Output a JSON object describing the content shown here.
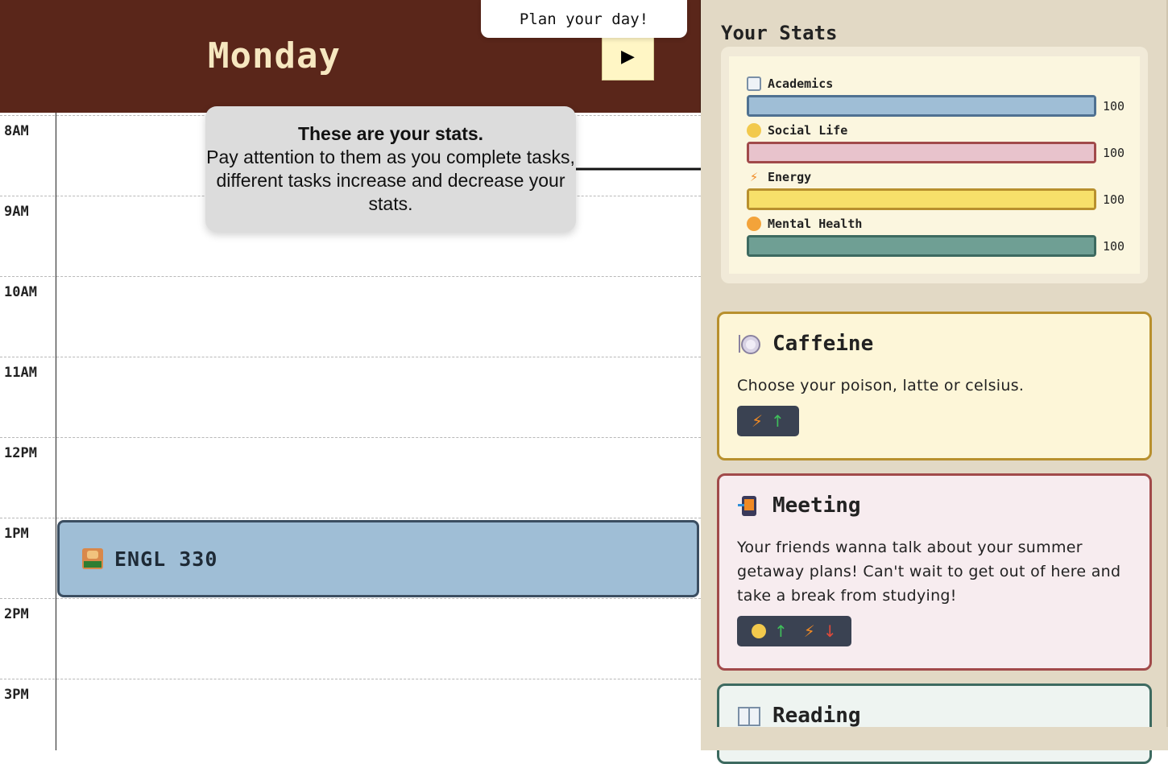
{
  "header": {
    "day": "Monday",
    "plan_tooltip": "Plan your day!"
  },
  "calendar": {
    "hours": [
      "8AM",
      "9AM",
      "10AM",
      "11AM",
      "12PM",
      "1PM",
      "2PM",
      "3PM"
    ],
    "events": [
      {
        "label": "ENGL 330",
        "icon": "teacher-icon",
        "color": "#9fbed6"
      }
    ]
  },
  "help": {
    "title": "These are your stats.",
    "body": "Pay attention to them as you complete tasks, different tasks increase and decrease your stats."
  },
  "stats": {
    "title": "Your Stats",
    "items": [
      {
        "name": "Academics",
        "value": "100",
        "fraction": 1.0,
        "color": "#9fbed6",
        "border": "#4f7191",
        "icon": "book-icon"
      },
      {
        "name": "Social Life",
        "value": "100",
        "fraction": 1.0,
        "color": "#e8c3cc",
        "border": "#a14a4a",
        "icon": "cheers-icon"
      },
      {
        "name": "Energy",
        "value": "100",
        "fraction": 1.0,
        "color": "#f7e06a",
        "border": "#b8902e",
        "icon": "lightning-icon"
      },
      {
        "name": "Mental Health",
        "value": "100",
        "fraction": 1.0,
        "color": "#6f9f94",
        "border": "#3d6a60",
        "icon": "smile-icon"
      }
    ]
  },
  "tasks": [
    {
      "title": "Caffeine",
      "desc": "Choose your poison, latte or celsius.",
      "icon": "plate-icon",
      "bg": "#fdf6d8",
      "border": "#b8902e",
      "effects": [
        "energy-up"
      ]
    },
    {
      "title": "Meeting",
      "desc": "Your friends wanna talk about your summer getaway plans! Can't wait to get out of here and take a break from studying!",
      "icon": "phone-icon",
      "bg": "#f7ecef",
      "border": "#a14a4a",
      "effects": [
        "social-up",
        "energy-down"
      ]
    },
    {
      "title": "Reading",
      "desc": "",
      "icon": "book-icon",
      "bg": "#eef4f1",
      "border": "#3d6a60",
      "effects": []
    }
  ]
}
